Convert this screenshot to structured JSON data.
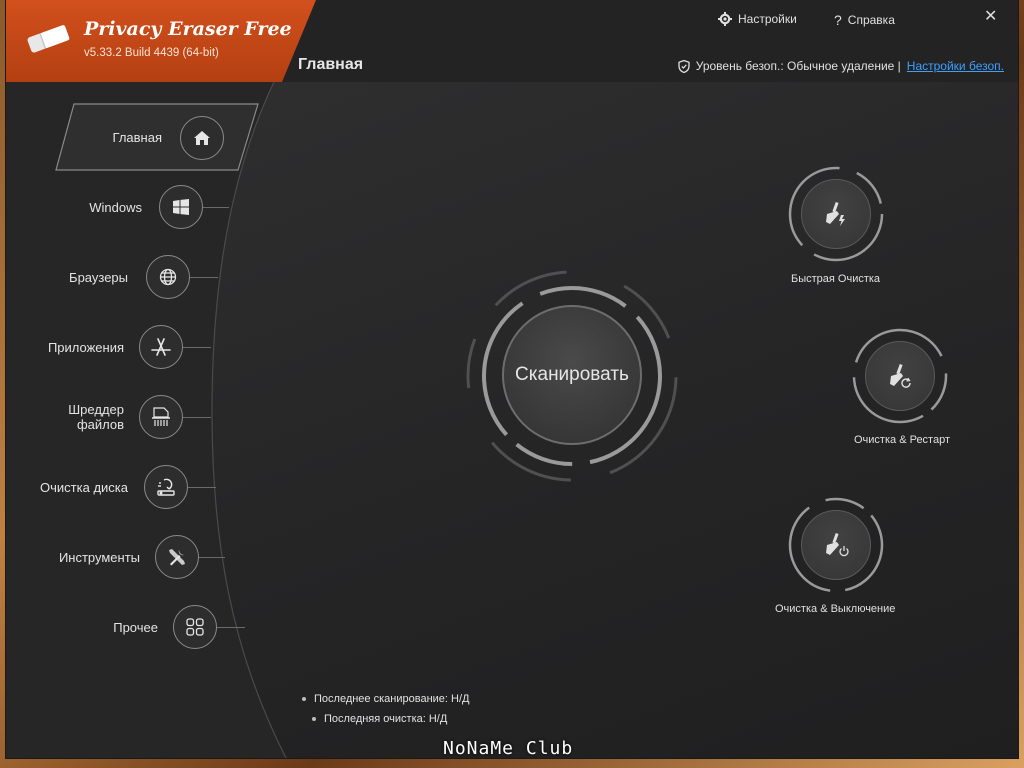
{
  "app": {
    "title": "Privacy Eraser Free",
    "version": "v5.33.2 Build 4439 (64-bit)"
  },
  "header": {
    "page_title": "Главная",
    "settings_label": "Настройки",
    "help_label": "Справка",
    "close_glyph": "✕",
    "security_prefix": "Уровень безоп.: Обычное удаление |",
    "security_link": "Настройки безоп."
  },
  "sidebar": {
    "items": [
      {
        "label": "Главная",
        "icon": "home-icon"
      },
      {
        "label": "Windows",
        "icon": "windows-icon"
      },
      {
        "label": "Браузеры",
        "icon": "globe-icon"
      },
      {
        "label": "Приложения",
        "icon": "app-store-icon"
      },
      {
        "label": "Шреддер\nфайлов",
        "icon": "shredder-icon"
      },
      {
        "label": "Очистка диска",
        "icon": "disk-wipe-icon"
      },
      {
        "label": "Инструменты",
        "icon": "tools-icon"
      },
      {
        "label": "Прочее",
        "icon": "grid-icon"
      }
    ]
  },
  "main": {
    "scan_label": "Сканировать",
    "actions": [
      {
        "label": "Быстрая Очистка",
        "icon": "broom-lightning-icon"
      },
      {
        "label": "Очистка & Рестарт",
        "icon": "broom-restart-icon"
      },
      {
        "label": "Очистка & Выключение",
        "icon": "broom-power-icon"
      }
    ],
    "last_scan": "Последнее сканирование:  Н/Д",
    "last_clean": "Последняя очистка:  Н/Д"
  },
  "watermark": "NoNaMe Club",
  "colors": {
    "accent": "#c9491a",
    "link": "#3fa0ff",
    "background": "#2b2b2c"
  }
}
